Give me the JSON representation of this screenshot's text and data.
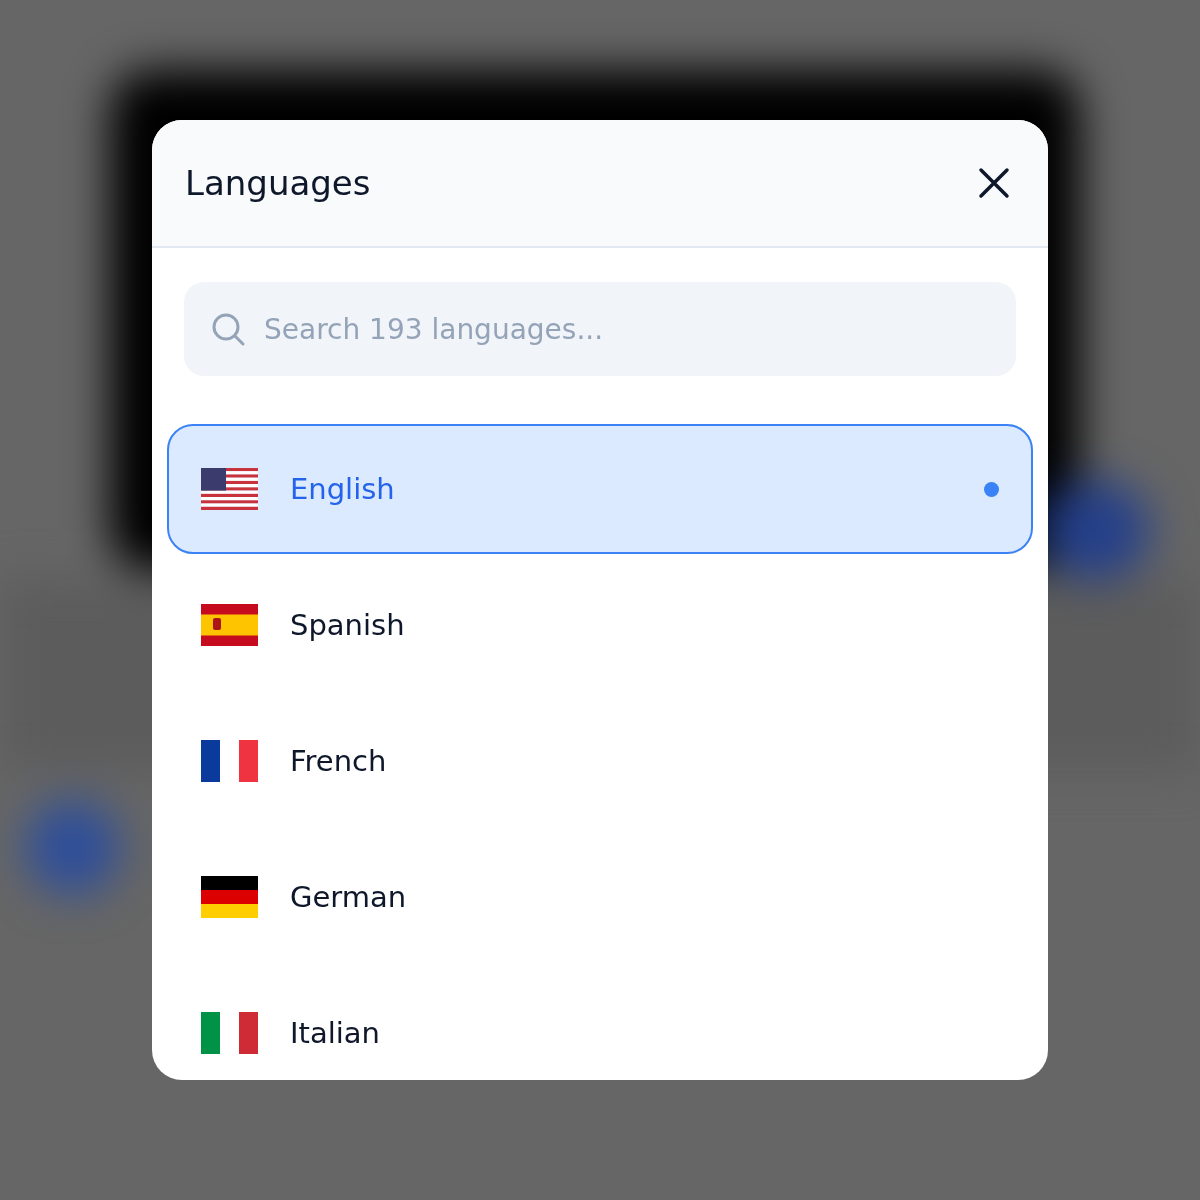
{
  "dialog": {
    "title": "Languages"
  },
  "search": {
    "placeholder": "Search 193 languages..."
  },
  "languages": [
    {
      "name": "English",
      "kind": "us",
      "selected": true
    },
    {
      "name": "Spanish",
      "kind": "es",
      "selected": false
    },
    {
      "name": "French",
      "kind": "fr",
      "selected": false
    },
    {
      "name": "German",
      "kind": "de",
      "selected": false
    },
    {
      "name": "Italian",
      "kind": "it",
      "selected": false
    }
  ]
}
